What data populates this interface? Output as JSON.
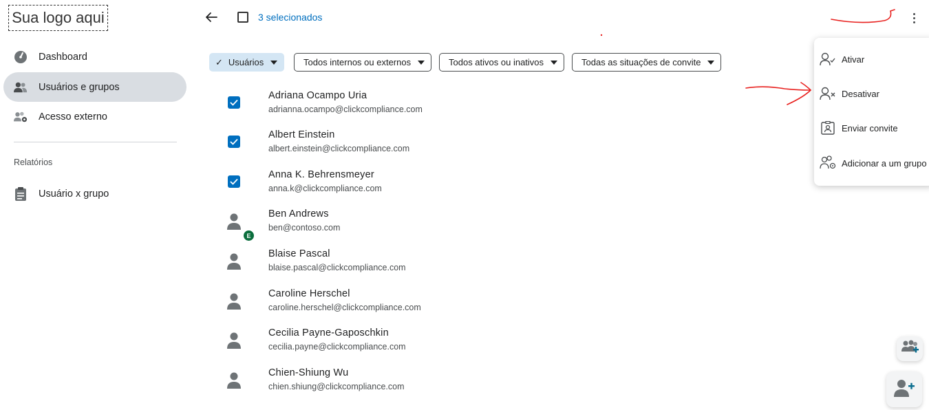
{
  "sidebar": {
    "logo_text": "Sua logo aqui",
    "items": [
      {
        "label": "Dashboard",
        "icon": "gauge-icon"
      },
      {
        "label": "Usuários e grupos",
        "icon": "users-icon"
      },
      {
        "label": "Acesso externo",
        "icon": "external-users-icon"
      }
    ],
    "reports_label": "Relatórios",
    "report_items": [
      {
        "label": "Usuário x grupo",
        "icon": "clipboard-icon"
      }
    ]
  },
  "header": {
    "selected_count": "3 selecionados"
  },
  "filters": [
    {
      "label": "Usuários",
      "selected": true
    },
    {
      "label": "Todos internos ou externos"
    },
    {
      "label": "Todos ativos ou inativos"
    },
    {
      "label": "Todas as situações de convite"
    }
  ],
  "users": [
    {
      "name": "Adriana Ocampo Uria",
      "email": "adrianna.ocampo@clickcompliance.com",
      "checked": true
    },
    {
      "name": "Albert Einstein",
      "email": "albert.einstein@clickcompliance.com",
      "checked": true
    },
    {
      "name": "Anna K. Behrensmeyer",
      "email": "anna.k@clickcompliance.com",
      "checked": true
    },
    {
      "name": "Ben Andrews",
      "email": "ben@contoso.com",
      "checked": false,
      "badge": "E"
    },
    {
      "name": "Blaise Pascal",
      "email": "blaise.pascal@clickcompliance.com",
      "checked": false
    },
    {
      "name": "Caroline Herschel",
      "email": "caroline.herschel@clickcompliance.com",
      "checked": false
    },
    {
      "name": "Cecilia Payne-Gaposchkin",
      "email": "cecilia.payne@clickcompliance.com",
      "checked": false
    },
    {
      "name": "Chien-Shiung Wu",
      "email": "chien.shiung@clickcompliance.com",
      "checked": false
    }
  ],
  "menu": [
    {
      "label": "Ativar",
      "icon": "user-check-icon"
    },
    {
      "label": "Desativar",
      "icon": "user-x-icon"
    },
    {
      "label": "Enviar convite",
      "icon": "id-card-icon"
    },
    {
      "label": "Adicionar a um grupo",
      "icon": "users-gear-icon"
    }
  ],
  "colors": {
    "accent": "#006fbf",
    "active_nav": "#d9dde2",
    "selected_filter": "#d4e6f4",
    "external_badge": "#0b6e3d",
    "annotation": "#e8201e"
  }
}
